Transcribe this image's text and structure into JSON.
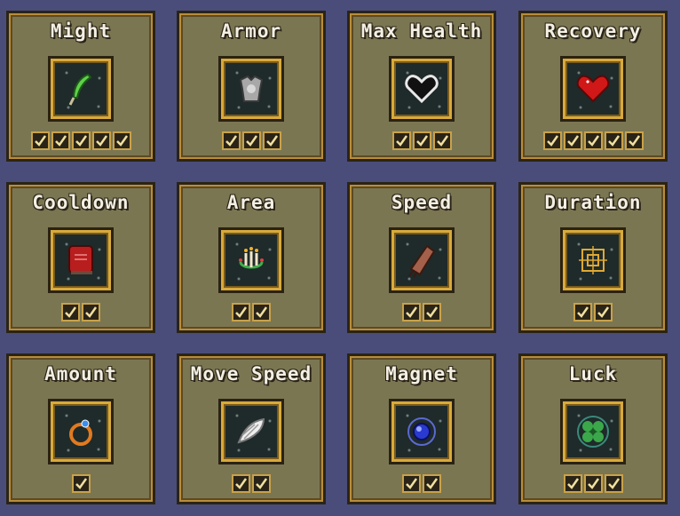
{
  "powerups": [
    {
      "name": "Might",
      "icon": "feather-icon",
      "level": 5
    },
    {
      "name": "Armor",
      "icon": "armor-icon",
      "level": 3
    },
    {
      "name": "Max Health",
      "icon": "heart-outline-icon",
      "level": 3
    },
    {
      "name": "Recovery",
      "icon": "heart-gem-icon",
      "level": 5
    },
    {
      "name": "Cooldown",
      "icon": "tome-icon",
      "level": 2
    },
    {
      "name": "Area",
      "icon": "candelabra-icon",
      "level": 2
    },
    {
      "name": "Speed",
      "icon": "bracer-icon",
      "level": 2
    },
    {
      "name": "Duration",
      "icon": "spellbinder-icon",
      "level": 2
    },
    {
      "name": "Amount",
      "icon": "ring-icon",
      "level": 1
    },
    {
      "name": "Move Speed",
      "icon": "wing-icon",
      "level": 2
    },
    {
      "name": "Magnet",
      "icon": "orb-icon",
      "level": 2
    },
    {
      "name": "Luck",
      "icon": "clover-icon",
      "level": 3
    }
  ],
  "colors": {
    "background": "#4a4d7a",
    "card": "#7b7652",
    "gold": "#d8aa3c"
  }
}
